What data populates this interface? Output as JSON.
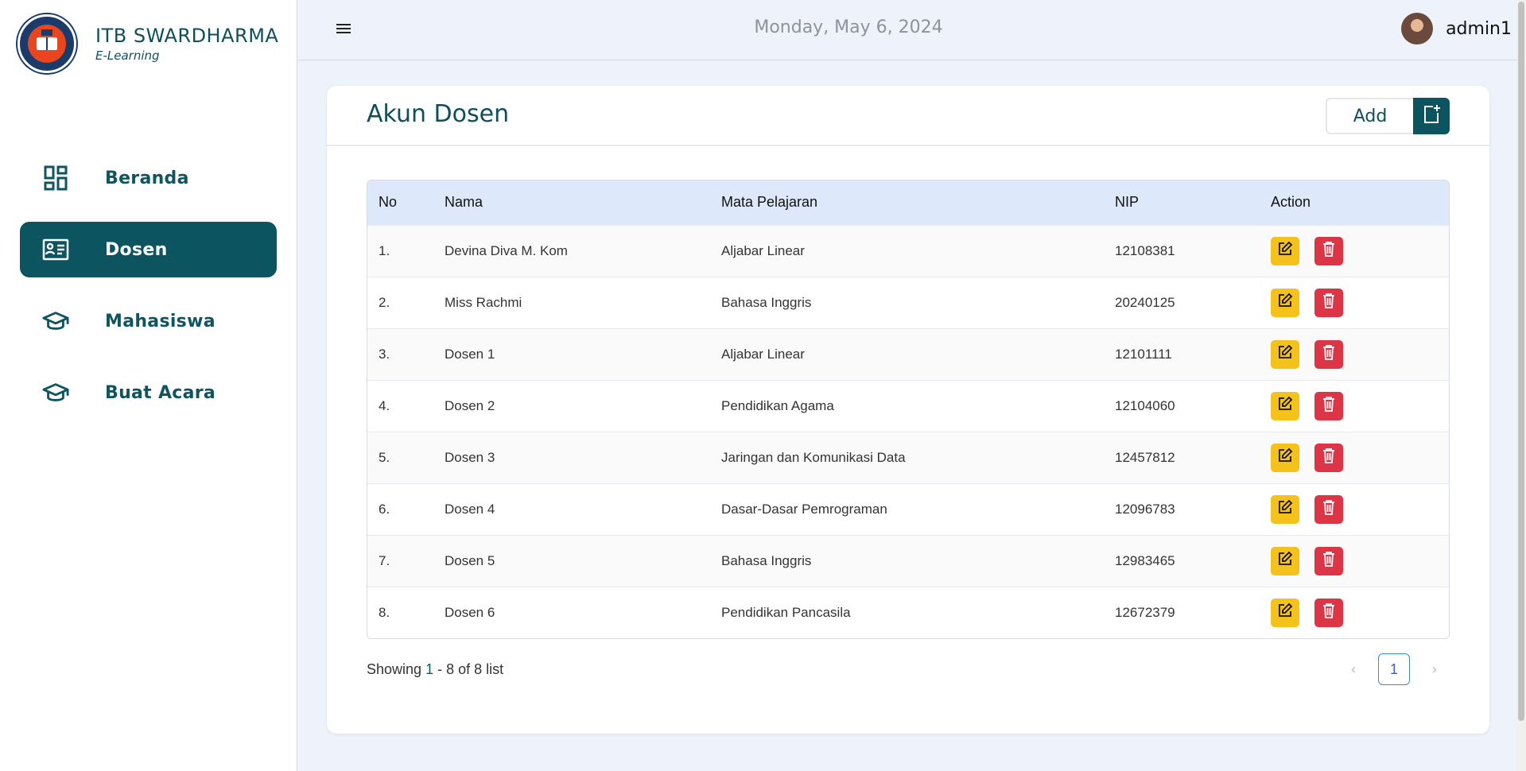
{
  "brand": {
    "title": "ITB SWARDHARMA",
    "subtitle": "E-Learning"
  },
  "nav": [
    {
      "label": "Beranda",
      "icon": "dashboard-icon",
      "active": false
    },
    {
      "label": "Dosen",
      "icon": "id-card-icon",
      "active": true
    },
    {
      "label": "Mahasiswa",
      "icon": "graduation-cap-icon",
      "active": false
    },
    {
      "label": "Buat Acara",
      "icon": "graduation-cap-icon",
      "active": false
    }
  ],
  "topbar": {
    "date": "Monday, May 6, 2024",
    "username": "admin1"
  },
  "page": {
    "title": "Akun Dosen",
    "add_label": "Add"
  },
  "table": {
    "headers": [
      "No",
      "Nama",
      "Mata Pelajaran",
      "NIP",
      "Action"
    ],
    "rows": [
      {
        "no": "1.",
        "nama": "Devina Diva M. Kom",
        "mapel": "Aljabar Linear",
        "nip": "12108381"
      },
      {
        "no": "2.",
        "nama": "Miss Rachmi",
        "mapel": "Bahasa Inggris",
        "nip": "20240125"
      },
      {
        "no": "3.",
        "nama": "Dosen 1",
        "mapel": "Aljabar Linear",
        "nip": "12101111"
      },
      {
        "no": "4.",
        "nama": "Dosen 2",
        "mapel": "Pendidikan Agama",
        "nip": "12104060"
      },
      {
        "no": "5.",
        "nama": "Dosen 3",
        "mapel": "Jaringan dan Komunikasi Data",
        "nip": "12457812"
      },
      {
        "no": "6.",
        "nama": "Dosen 4",
        "mapel": "Dasar-Dasar Pemrograman",
        "nip": "12096783"
      },
      {
        "no": "7.",
        "nama": "Dosen 5",
        "mapel": "Bahasa Inggris",
        "nip": "12983465"
      },
      {
        "no": "8.",
        "nama": "Dosen 6",
        "mapel": "Pendidikan Pancasila",
        "nip": "12672379"
      }
    ]
  },
  "footer": {
    "prefix": "Showing ",
    "range_start": "1",
    "range_rest": " - 8 of 8 list",
    "current_page": "1"
  },
  "colors": {
    "primary": "#0b5460",
    "edit": "#f5c21b",
    "delete": "#dc3545",
    "header_bg": "#dde8fa"
  }
}
